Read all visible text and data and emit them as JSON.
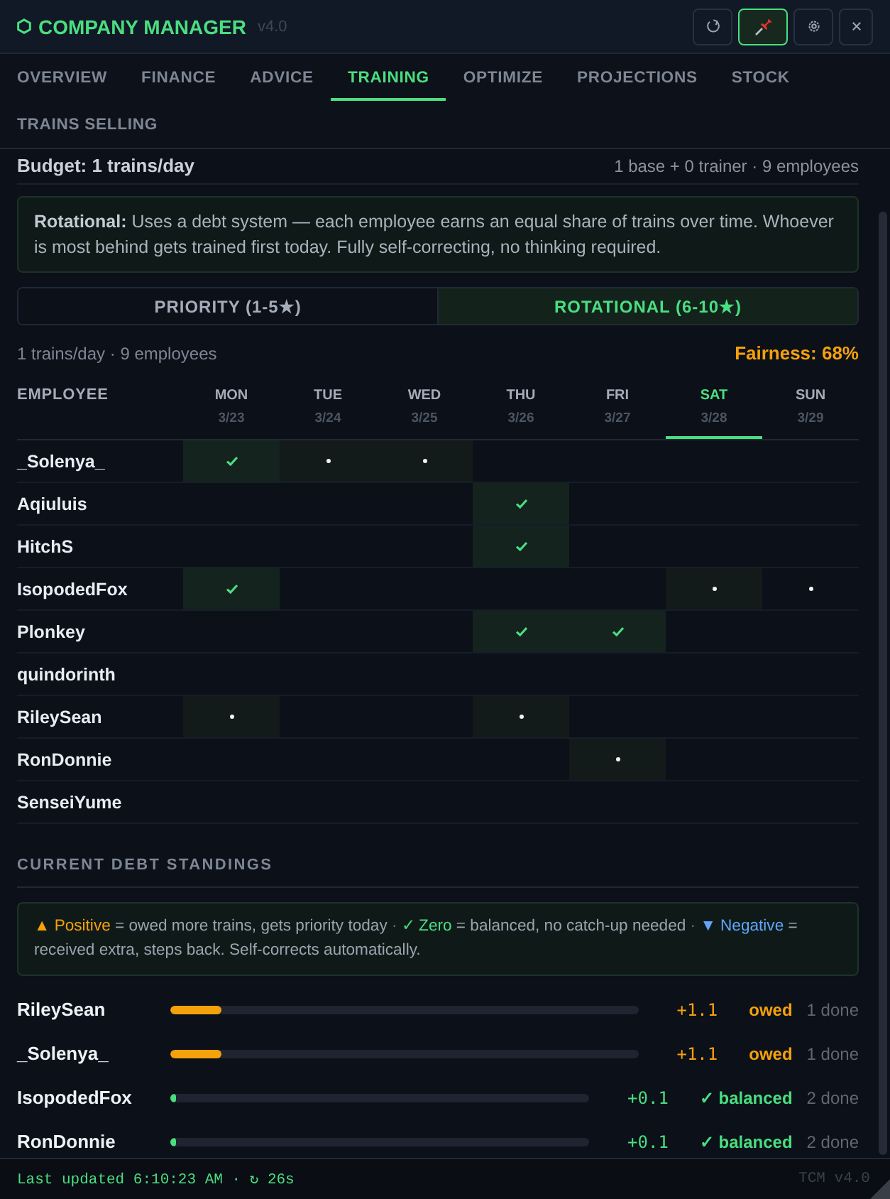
{
  "header": {
    "title": "COMPANY MANAGER",
    "version": "v4.0",
    "pinned": true
  },
  "tabs": [
    {
      "label": "OVERVIEW",
      "selected": false
    },
    {
      "label": "FINANCE",
      "selected": false
    },
    {
      "label": "ADVICE",
      "selected": false
    },
    {
      "label": "TRAINING",
      "selected": true
    },
    {
      "label": "OPTIMIZE",
      "selected": false
    },
    {
      "label": "PROJECTIONS",
      "selected": false
    },
    {
      "label": "STOCK",
      "selected": false
    },
    {
      "label": "TRAINS SELLING",
      "selected": false
    }
  ],
  "budget": {
    "label": "Budget: 1 trains/day",
    "detail": "1 base + 0 trainer · 9 employees"
  },
  "mode_description": "**Rotational:** Uses a debt system — each employee earns an equal share of trains over time. Whoever is most behind gets trained first today. Fully self-correcting, no thinking required.",
  "modes": [
    {
      "label": "PRIORITY (1-5★)",
      "selected": false
    },
    {
      "label": "ROTATIONAL (6-10★)",
      "selected": true
    }
  ],
  "summary": {
    "text": "1 trains/day · 9 employees",
    "fairness": "Fairness: 68%"
  },
  "schedule": {
    "employee_header": "EMPLOYEE",
    "days": [
      {
        "name": "MON",
        "date": "3/23",
        "today": false
      },
      {
        "name": "TUE",
        "date": "3/24",
        "today": false
      },
      {
        "name": "WED",
        "date": "3/25",
        "today": false
      },
      {
        "name": "THU",
        "date": "3/26",
        "today": false
      },
      {
        "name": "FRI",
        "date": "3/27",
        "today": false
      },
      {
        "name": "SAT",
        "date": "3/28",
        "today": true
      },
      {
        "name": "SUN",
        "date": "3/29",
        "today": false
      }
    ],
    "rows": [
      {
        "name": "_Solenya_",
        "days": [
          {
            "kind": "trained"
          },
          {
            "kind": "planned"
          },
          {
            "kind": "planned"
          },
          {
            "kind": "none"
          },
          {
            "kind": "none"
          },
          {
            "kind": "none"
          },
          {
            "kind": "none"
          }
        ]
      },
      {
        "name": "Aqiuluis",
        "days": [
          {
            "kind": "none"
          },
          {
            "kind": "none"
          },
          {
            "kind": "none"
          },
          {
            "kind": "trained"
          },
          {
            "kind": "none"
          },
          {
            "kind": "none"
          },
          {
            "kind": "none"
          }
        ]
      },
      {
        "name": "HitchS",
        "days": [
          {
            "kind": "none"
          },
          {
            "kind": "none"
          },
          {
            "kind": "none"
          },
          {
            "kind": "trained"
          },
          {
            "kind": "none"
          },
          {
            "kind": "none"
          },
          {
            "kind": "none"
          }
        ]
      },
      {
        "name": "IsopodedFox",
        "days": [
          {
            "kind": "trained"
          },
          {
            "kind": "none"
          },
          {
            "kind": "none"
          },
          {
            "kind": "none"
          },
          {
            "kind": "none"
          },
          {
            "kind": "planned"
          },
          {
            "kind": "upcoming"
          }
        ]
      },
      {
        "name": "Plonkey",
        "days": [
          {
            "kind": "none"
          },
          {
            "kind": "none"
          },
          {
            "kind": "none"
          },
          {
            "kind": "trained"
          },
          {
            "kind": "trained"
          },
          {
            "kind": "none"
          },
          {
            "kind": "none"
          }
        ]
      },
      {
        "name": "quindorinth",
        "days": [
          {
            "kind": "none"
          },
          {
            "kind": "none"
          },
          {
            "kind": "none"
          },
          {
            "kind": "none"
          },
          {
            "kind": "none"
          },
          {
            "kind": "none"
          },
          {
            "kind": "none"
          }
        ]
      },
      {
        "name": "RileySean",
        "days": [
          {
            "kind": "planned"
          },
          {
            "kind": "none"
          },
          {
            "kind": "none"
          },
          {
            "kind": "planned"
          },
          {
            "kind": "none"
          },
          {
            "kind": "none"
          },
          {
            "kind": "none"
          }
        ]
      },
      {
        "name": "RonDonnie",
        "days": [
          {
            "kind": "none"
          },
          {
            "kind": "none"
          },
          {
            "kind": "none"
          },
          {
            "kind": "none"
          },
          {
            "kind": "planned"
          },
          {
            "kind": "none"
          },
          {
            "kind": "none"
          }
        ]
      },
      {
        "name": "SenseiYume",
        "days": [
          {
            "kind": "none"
          },
          {
            "kind": "none"
          },
          {
            "kind": "none"
          },
          {
            "kind": "none"
          },
          {
            "kind": "none"
          },
          {
            "kind": "none"
          },
          {
            "kind": "none"
          }
        ]
      }
    ]
  },
  "debt_section": {
    "title": "CURRENT DEBT STANDINGS",
    "legend": [
      {
        "kind": "positive",
        "term": "▲ Positive",
        "meaning": "= owed more trains, gets priority today",
        "separator": "·"
      },
      {
        "kind": "zero",
        "term": "✓ Zero",
        "meaning": "= balanced, no catch-up needed",
        "separator": "·"
      },
      {
        "kind": "negative",
        "term": "▼ Negative",
        "meaning": "= received extra, steps back. Self-corrects automatically."
      }
    ]
  },
  "debts": [
    {
      "name": "RileySean",
      "kind": "positive",
      "level": 0.11,
      "value": "+1.1",
      "status": "owed",
      "done": "1 done"
    },
    {
      "name": "_Solenya_",
      "kind": "positive",
      "level": 0.11,
      "value": "+1.1",
      "status": "owed",
      "done": "1 done"
    },
    {
      "name": "IsopodedFox",
      "kind": "zero",
      "level": 0.01,
      "value": "+0.1",
      "status": "✓ balanced",
      "done": "2 done"
    },
    {
      "name": "RonDonnie",
      "kind": "zero",
      "level": 0.01,
      "value": "+0.1",
      "status": "✓ balanced",
      "done": "2 done"
    }
  ],
  "footer": {
    "status": "Last updated 6:10:23 AM · ↻ 26s",
    "version": "TCM v4.0"
  }
}
